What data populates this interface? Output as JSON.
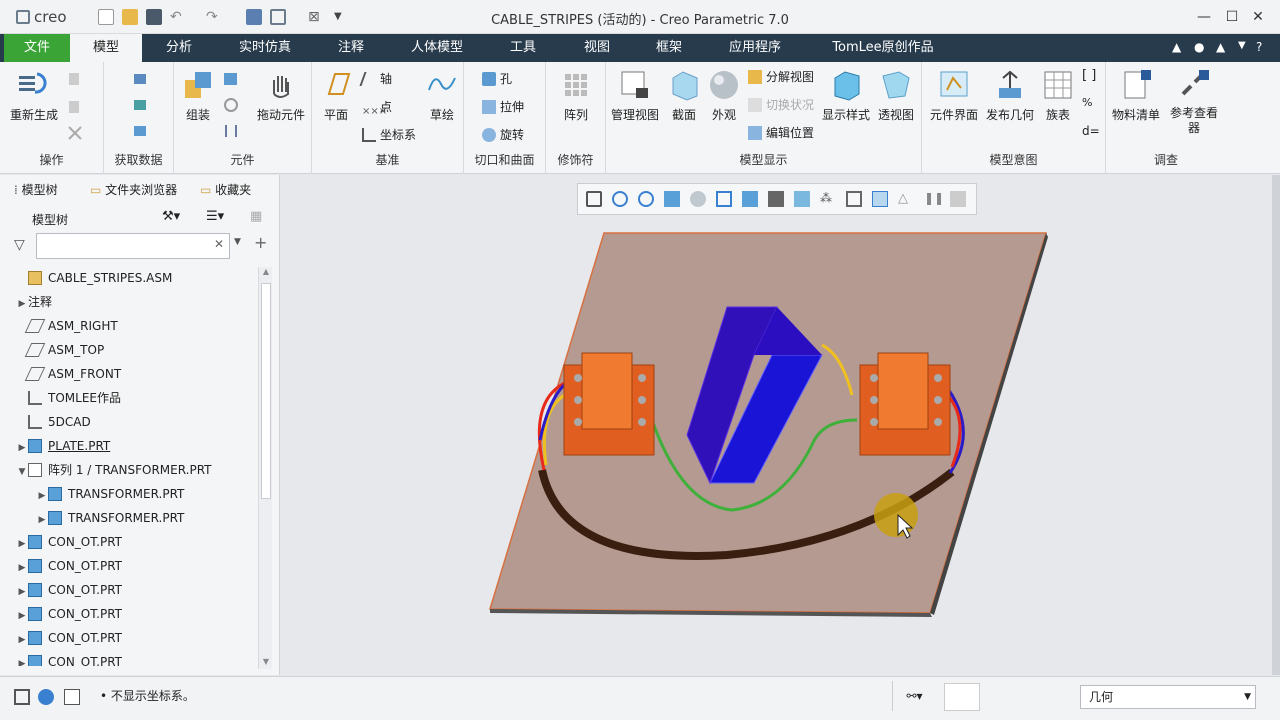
{
  "app": {
    "logo": "creo",
    "window_title": "CABLE_STRIPES (活动的) - Creo Parametric 7.0"
  },
  "tabs": [
    "文件",
    "模型",
    "分析",
    "实时仿真",
    "注释",
    "人体模型",
    "工具",
    "视图",
    "框架",
    "应用程序",
    "TomLee原创作品"
  ],
  "ribbon": {
    "groups": {
      "operations": "操作",
      "get_data": "获取数据",
      "component": "元件",
      "datum": "基准",
      "cut_surface": "切口和曲面",
      "modifiers": "修饰符",
      "model_display": "模型显示",
      "model_intent": "模型意图",
      "investigate": "调查"
    },
    "buttons": {
      "regenerate": "重新生成",
      "assemble": "组装",
      "drag": "拖动元件",
      "plane": "平面",
      "axis": "轴",
      "point": "点",
      "csys": "坐标系",
      "sketch": "草绘",
      "hole": "孔",
      "extrude": "拉伸",
      "revolve": "旋转",
      "pattern": "阵列",
      "manage_views": "管理视图",
      "section": "截面",
      "appearance": "外观",
      "explode_view": "分解视图",
      "toggle_status": "切换状况",
      "edit_position": "编辑位置",
      "display_style": "显示样式",
      "perspective": "透视图",
      "component_interface": "元件界面",
      "publish_geometry": "发布几何",
      "family_table": "族表",
      "bom": "物料清单",
      "ref_viewer": "参考查看器"
    }
  },
  "panel": {
    "tabs": [
      "模型树",
      "文件夹浏览器",
      "收藏夹"
    ],
    "tree_header": "模型树",
    "filter_placeholder": "",
    "items": [
      {
        "label": "CABLE_STRIPES.ASM",
        "level": 0,
        "arrow": "",
        "icon": "assembly"
      },
      {
        "label": "注释",
        "level": 0,
        "arrow": "▶",
        "icon": "none"
      },
      {
        "label": "ASM_RIGHT",
        "level": 0,
        "arrow": "",
        "icon": "plane"
      },
      {
        "label": "ASM_TOP",
        "level": 0,
        "arrow": "",
        "icon": "plane"
      },
      {
        "label": "ASM_FRONT",
        "level": 0,
        "arrow": "",
        "icon": "plane"
      },
      {
        "label": "TOMLEE作品",
        "level": 0,
        "arrow": "",
        "icon": "csys"
      },
      {
        "label": "5DCAD",
        "level": 0,
        "arrow": "",
        "icon": "csys"
      },
      {
        "label": "PLATE.PRT",
        "level": 0,
        "arrow": "▶",
        "icon": "part",
        "underline": true
      },
      {
        "label": "阵列 1 / TRANSFORMER.PRT",
        "level": 0,
        "arrow": "▼",
        "icon": "pattern"
      },
      {
        "label": "TRANSFORMER.PRT",
        "level": 1,
        "arrow": "▶",
        "icon": "part"
      },
      {
        "label": "TRANSFORMER.PRT",
        "level": 1,
        "arrow": "▶",
        "icon": "part"
      },
      {
        "label": "CON_OT.PRT",
        "level": 0,
        "arrow": "▶",
        "icon": "part"
      },
      {
        "label": "CON_OT.PRT",
        "level": 0,
        "arrow": "▶",
        "icon": "part"
      },
      {
        "label": "CON_OT.PRT",
        "level": 0,
        "arrow": "▶",
        "icon": "part"
      },
      {
        "label": "CON_OT.PRT",
        "level": 0,
        "arrow": "▶",
        "icon": "part"
      },
      {
        "label": "CON_OT.PRT",
        "level": 0,
        "arrow": "▶",
        "icon": "part"
      },
      {
        "label": "CON_OT.PRT",
        "level": 0,
        "arrow": "▶",
        "icon": "part"
      }
    ]
  },
  "status": {
    "message": "• 不显示坐标系。",
    "filter_value": "几何"
  },
  "colors": {
    "tabbar": "#273b4c",
    "file_tab": "#3aa536",
    "plate": "#b59a92",
    "transformer": "#f07a30",
    "box": "#1a14d6",
    "cable": "#3a1f10"
  }
}
